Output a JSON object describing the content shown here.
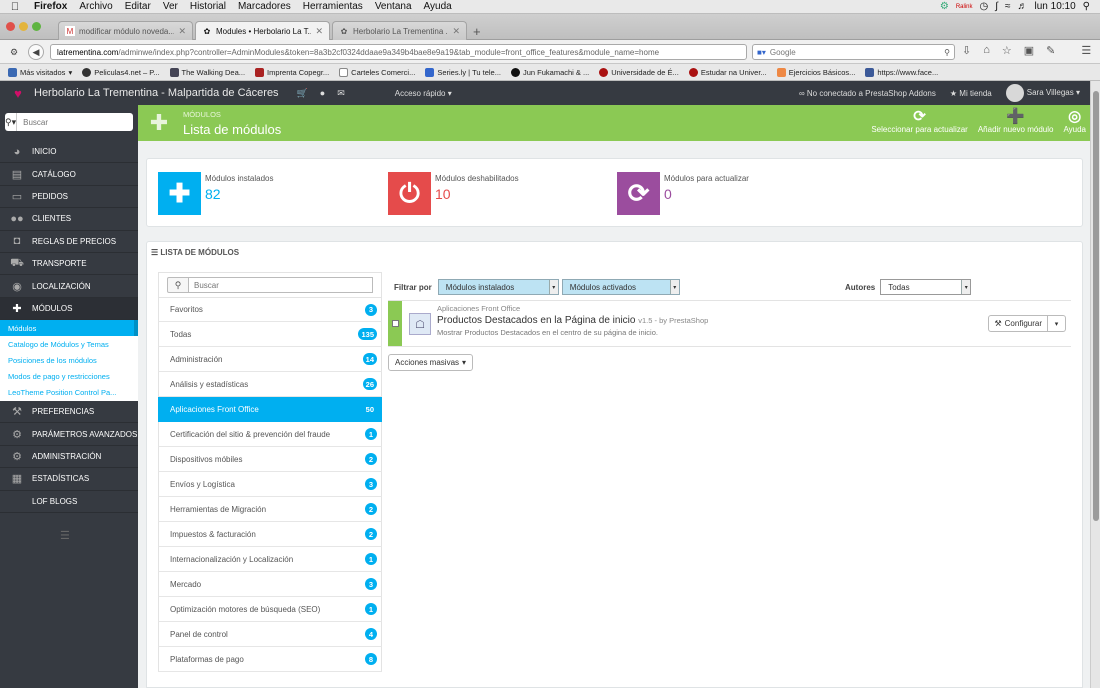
{
  "mac": {
    "app": "Firefox",
    "menus": [
      "Archivo",
      "Editar",
      "Ver",
      "Historial",
      "Marcadores",
      "Herramientas",
      "Ventana",
      "Ayuda"
    ],
    "clock": "lun 10:10",
    "ralink": "Ralink"
  },
  "browser": {
    "tabs": [
      {
        "title": "modificar módulo noveda..."
      },
      {
        "title": "Modules • Herbolario La T..."
      },
      {
        "title": "Herbolario La Trementina ..."
      }
    ],
    "url_domain": "latrementina.com",
    "url_path": "/adminwe/index.php?controller=AdminModules&token=8a3b2cf0324ddaae9a349b4bae8e9a19&tab_module=front_office_features&module_name=home",
    "search_placeholder": "Google",
    "bookmarks": [
      "Más visitados",
      "Peliculas4.net – P...",
      "The Walking Dea...",
      "Imprenta Copegr...",
      "Carteles Comerci...",
      "Series.ly | Tu tele...",
      "Jun Fukamachi & ...",
      "Universidade de É...",
      "Estudar na Univer...",
      "Ejercicios Básicos...",
      "https://www.face..."
    ]
  },
  "header": {
    "shop_name": "Herbolario La Trementina - Malpartida de Cáceres",
    "quick_access": "Acceso rápido",
    "addons": "No conectado a PrestaShop Addons",
    "my_shop": "Mi tienda",
    "user": "Sara Villegas"
  },
  "sidebar": {
    "search_placeholder": "Buscar",
    "items": [
      {
        "label": "Inicio"
      },
      {
        "label": "Catálogo"
      },
      {
        "label": "Pedidos"
      },
      {
        "label": "Clientes"
      },
      {
        "label": "Reglas de precios"
      },
      {
        "label": "Transporte"
      },
      {
        "label": "Localización"
      },
      {
        "label": "Módulos"
      }
    ],
    "submenu": [
      "Módulos",
      "Catalogo de Módulos y Temas",
      "Posiciones de los módulos",
      "Modos de pago y restricciones",
      "LeoTheme Position Control Pa..."
    ],
    "items_after": [
      {
        "label": "Preferencias"
      },
      {
        "label": "Parámetros avanzados"
      },
      {
        "label": "Administración"
      },
      {
        "label": "Estadísticas"
      },
      {
        "label": "LOF BLOGS"
      }
    ]
  },
  "toolbar": {
    "breadcrumb": "MÓDULOS",
    "title": "Lista de módulos",
    "buttons": [
      "Seleccionar para actualizar",
      "Añadir nuevo módulo",
      "Ayuda"
    ]
  },
  "kpis": [
    {
      "label": "Módulos instalados",
      "value": "82",
      "color": "#00aff0"
    },
    {
      "label": "Módulos deshabilitados",
      "value": "10",
      "color": "#e54b4b"
    },
    {
      "label": "Módulos para actualizar",
      "value": "0",
      "color": "#9b4d9e"
    }
  ],
  "modules_panel": {
    "heading": "LISTA DE MÓDULOS",
    "search_placeholder": "Buscar",
    "categories": [
      {
        "name": "Favoritos",
        "count": "3"
      },
      {
        "name": "Todas",
        "count": "135"
      },
      {
        "name": "Administración",
        "count": "14"
      },
      {
        "name": "Análisis y estadísticas",
        "count": "26"
      },
      {
        "name": "Aplicaciones Front Office",
        "count": "50"
      },
      {
        "name": "Certificación del sitio & prevención del fraude",
        "count": "1"
      },
      {
        "name": "Dispositivos móbiles",
        "count": "2"
      },
      {
        "name": "Envíos y Logística",
        "count": "3"
      },
      {
        "name": "Herramientas de Migración",
        "count": "2"
      },
      {
        "name": "Impuestos & facturación",
        "count": "2"
      },
      {
        "name": "Internacionalización y Localización",
        "count": "1"
      },
      {
        "name": "Mercado",
        "count": "3"
      },
      {
        "name": "Optimización motores de búsqueda (SEO)",
        "count": "1"
      },
      {
        "name": "Panel de control",
        "count": "4"
      },
      {
        "name": "Plataformas de pago",
        "count": "8"
      }
    ],
    "filter_label": "Filtrar por",
    "filter1": "Módulos instalados",
    "filter2": "Módulos activados",
    "authors_label": "Autores",
    "authors_value": "Todas",
    "module": {
      "category": "Aplicaciones Front Office",
      "name": "Productos Destacados en la Página de inicio",
      "version": "v1.5 - by PrestaShop",
      "description": "Mostrar Productos Destacados en el centro de su página de inicio.",
      "configure": "Configurar"
    },
    "bulk_actions": "Acciones masivas"
  }
}
